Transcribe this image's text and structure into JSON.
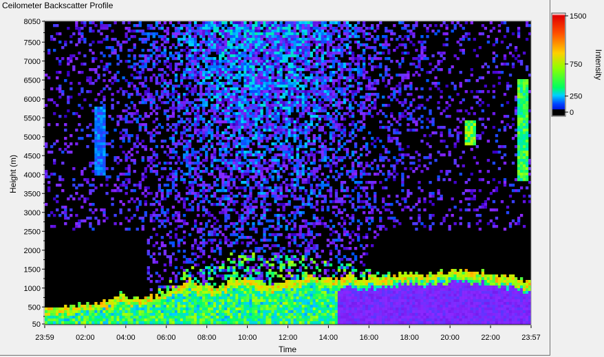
{
  "window": {
    "title": "Ceilometer Backscatter Profile"
  },
  "chart_data": {
    "type": "heatmap",
    "title": "Ceilometer Backscatter Profile",
    "xlabel": "Time",
    "ylabel": "Height (m)",
    "x_ticks": [
      "23:59",
      "02:00",
      "04:00",
      "06:00",
      "08:00",
      "10:00",
      "12:00",
      "14:00",
      "16:00",
      "18:00",
      "20:00",
      "22:00",
      "23:57"
    ],
    "y_ticks": [
      50,
      500,
      1000,
      1500,
      2000,
      2500,
      3000,
      3500,
      4000,
      4500,
      5000,
      5500,
      6000,
      6500,
      7000,
      7500,
      8050
    ],
    "ylim": [
      50,
      8050
    ],
    "colorbar": {
      "label": "Intensity",
      "ticks": [
        0,
        250,
        750,
        1500
      ],
      "range": [
        0,
        1500
      ],
      "colors": [
        "#000000",
        "#0033ff",
        "#00ccff",
        "#00ff66",
        "#ccff00",
        "#ff9900",
        "#ff0000",
        "#ffffff"
      ]
    },
    "grid": false,
    "features": {
      "boundary_layer_height_m": [
        450,
        500,
        600,
        800,
        700,
        900,
        1200,
        1000,
        1300,
        1100,
        1200,
        1300,
        1250,
        1300,
        1300,
        1400,
        1350,
        1500,
        1450,
        1300,
        1200
      ],
      "cloud_layers": [
        {
          "time": "02:40",
          "height_range": [
            4000,
            5800
          ],
          "intensity": 400
        },
        {
          "time": "21:00",
          "height_range": [
            4800,
            5400
          ],
          "intensity": 900
        },
        {
          "time": "23:40",
          "height_range": [
            3800,
            6500
          ],
          "intensity": 800
        }
      ]
    }
  }
}
